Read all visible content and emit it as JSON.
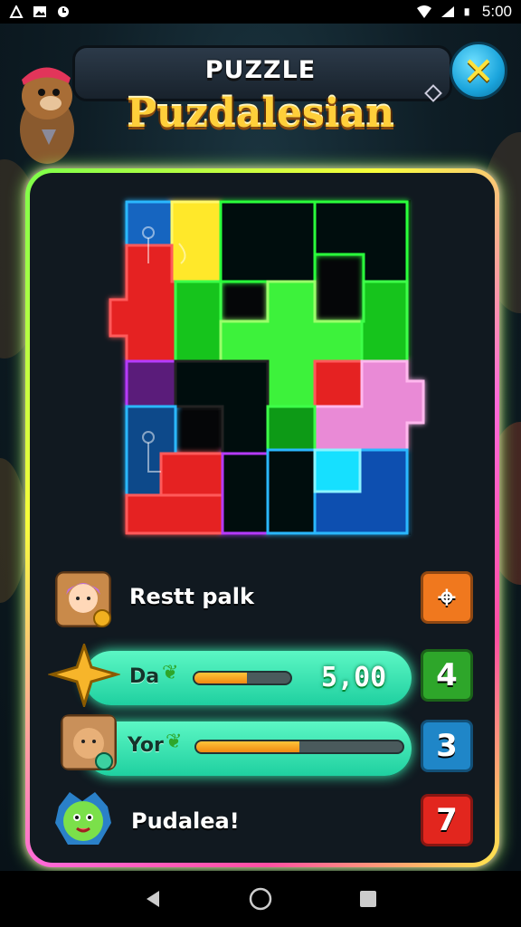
{
  "status_bar": {
    "time": "5:00",
    "left_icons": [
      "notification-a-icon",
      "image-icon",
      "clock-icon"
    ],
    "right_icons": [
      "wifi-icon",
      "signal-icon",
      "battery-icon"
    ]
  },
  "header": {
    "title_small": "PUZZLE",
    "title_big": "Puzdalesian",
    "close_glyph": "✕"
  },
  "rows": [
    {
      "label": "Restt palk",
      "button_glyph": "⌖",
      "button_color": "#f0781e"
    },
    {
      "label": "Da",
      "score": "5,00",
      "progress": 0.55,
      "button_value": "4",
      "button_color": "#2ea62a"
    },
    {
      "label": "Yor",
      "progress": 0.5,
      "button_value": "3",
      "button_color": "#1f86c8"
    },
    {
      "label": "Pudalea!",
      "button_value": "7",
      "button_color": "#e2261e"
    }
  ],
  "colors": {
    "accent_green": "#3cf4b5",
    "neon_red": "#ff2a2a",
    "neon_yellow": "#ffe82a",
    "neon_green": "#2bff3a",
    "neon_pink": "#ff8ce0",
    "neon_blue": "#2ab8ff",
    "neon_purple": "#b63bff"
  },
  "nav": [
    "back-icon",
    "home-icon",
    "recents-icon"
  ]
}
